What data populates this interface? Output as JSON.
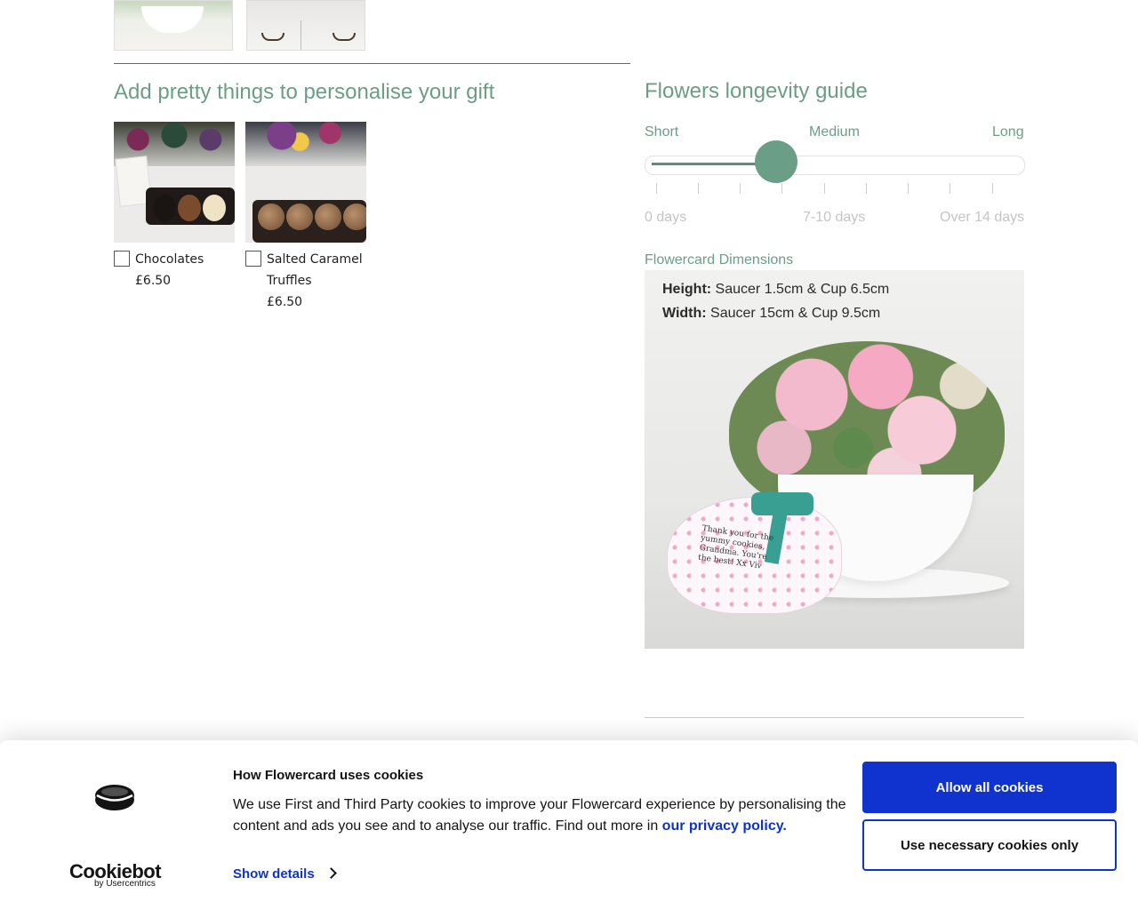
{
  "addons": {
    "title": "Add pretty things to personalise your gift",
    "items": [
      {
        "name": "Chocolates",
        "price": "£6.50"
      },
      {
        "name": "Salted Caramel Truffles",
        "price": "£6.50"
      }
    ]
  },
  "longevity": {
    "title": "Flowers longevity guide",
    "scale_labels": [
      "Short",
      "Medium",
      "Long"
    ],
    "day_labels": [
      "0 days",
      "7-10 days",
      "Over 14 days"
    ],
    "level": 0.34,
    "accent_color": "#6b9e87"
  },
  "dimensions": {
    "title": "Flowercard Dimensions",
    "height_label": "Height:",
    "height_value": " Saucer 1.5cm & Cup 6.5cm",
    "width_label": "Width:",
    "width_value": " Saucer 15cm & Cup 9.5cm",
    "card_message": "Thank you for the yummy cookies, Grandma. You're the best! Xx Viv"
  },
  "cookie_banner": {
    "brand": "Cookiebot",
    "brand_sub": "by Usercentrics",
    "title": "How Flowercard uses cookies",
    "body": "We use First and Third Party cookies to improve your Flowercard experience by personalising the content and ads you see and to analyse our traffic. Find out more in ",
    "privacy_link": "our privacy policy.",
    "show_details": "Show details",
    "allow_all": "Allow all cookies",
    "necessary_only": "Use necessary cookies only",
    "accent_color": "#1032cf"
  }
}
